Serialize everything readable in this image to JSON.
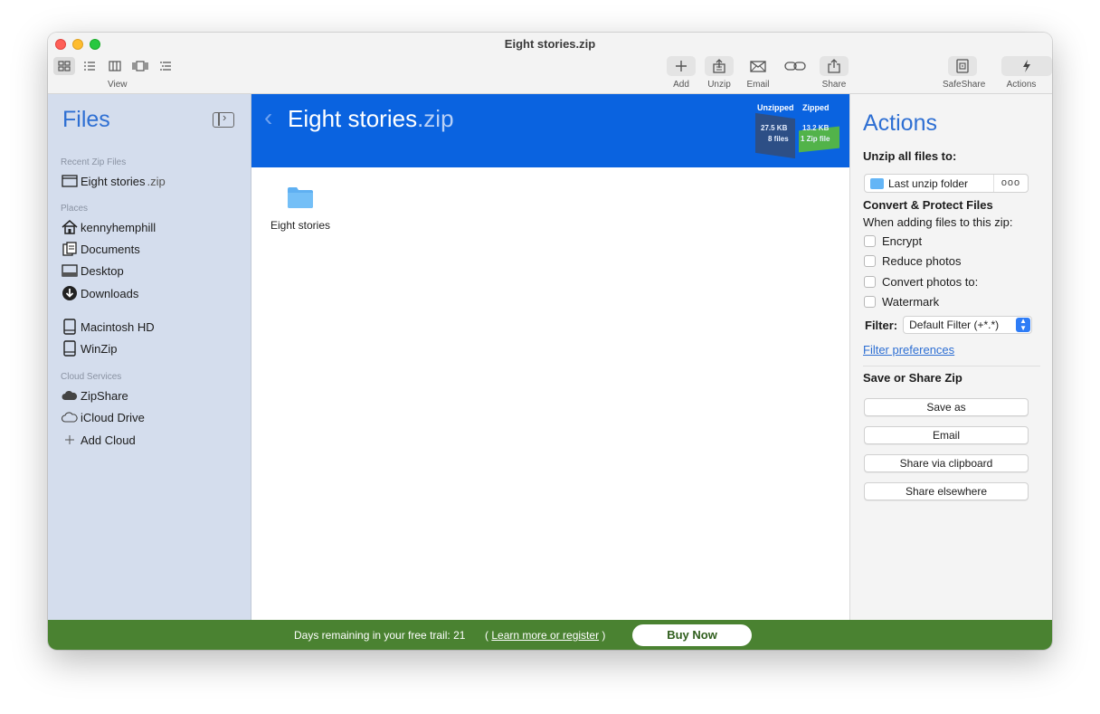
{
  "window": {
    "title": "Eight stories.zip"
  },
  "toolbar": {
    "view_label": "View",
    "add_label": "Add",
    "unzip_label": "Unzip",
    "email_label": "Email",
    "share_label": "Share",
    "safeshare_label": "SafeShare",
    "actions_label": "Actions"
  },
  "sidebar": {
    "title": "Files",
    "recent_header": "Recent Zip Files",
    "recent": [
      {
        "name": "Eight stories",
        "ext": ".zip",
        "icon": "zip-file-icon"
      }
    ],
    "places_header": "Places",
    "places": [
      {
        "label": "kennyhemphill",
        "icon": "home-icon"
      },
      {
        "label": "Documents",
        "icon": "documents-icon"
      },
      {
        "label": "Desktop",
        "icon": "desktop-icon"
      },
      {
        "label": "Downloads",
        "icon": "downloads-icon"
      },
      {
        "label": "Macintosh HD",
        "icon": "drive-icon"
      },
      {
        "label": "WinZip",
        "icon": "drive-icon"
      }
    ],
    "cloud_header": "Cloud Services",
    "cloud": [
      {
        "label": "ZipShare",
        "icon": "cloud-filled-icon"
      },
      {
        "label": "iCloud Drive",
        "icon": "cloud-outline-icon"
      },
      {
        "label": "Add Cloud",
        "icon": "plus-icon"
      }
    ]
  },
  "center": {
    "title_name": "Eight stories",
    "title_ext": ".zip",
    "stats": {
      "unzipped_header": "Unzipped",
      "zipped_header": "Zipped",
      "unzipped_size": "27.5 KB",
      "unzipped_count": "8 files",
      "zipped_size": "13.2 KB",
      "zipped_count": "1 Zip file"
    },
    "items": [
      {
        "label": "Eight stories",
        "icon": "folder-icon"
      }
    ]
  },
  "actions": {
    "title": "Actions",
    "unzip_header": "Unzip all files to:",
    "unzip_target": "Last unzip folder",
    "unzip_more": "ooo",
    "convert_header": "Convert & Protect Files",
    "convert_sub": "When adding files to this zip:",
    "options": [
      {
        "label": "Encrypt",
        "checked": false
      },
      {
        "label": "Reduce photos",
        "checked": false
      },
      {
        "label": "Convert photos to:",
        "checked": false
      },
      {
        "label": "Watermark",
        "checked": false
      }
    ],
    "filter_label": "Filter:",
    "filter_value": "Default Filter (+*.*)",
    "filter_link": "Filter preferences",
    "save_header": "Save or Share Zip",
    "buttons": [
      "Save as",
      "Email",
      "Share via clipboard",
      "Share elsewhere"
    ]
  },
  "footer": {
    "trial_text": "Days remaining in your free trail: 21",
    "link_text": "Learn more or register",
    "buy_label": "Buy Now"
  },
  "colors": {
    "accent_blue": "#2e6fd3",
    "banner_blue": "#0a63e0",
    "sidebar_bg": "#d4dded",
    "footer_green": "#4a8231"
  }
}
